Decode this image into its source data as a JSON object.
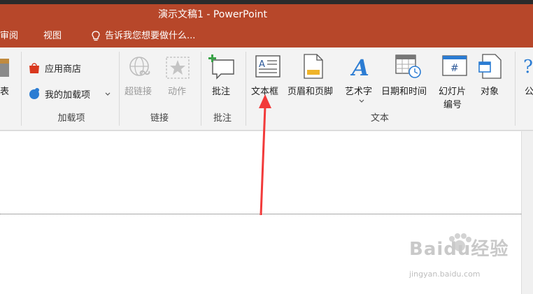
{
  "window": {
    "title": "演示文稿1 - PowerPoint"
  },
  "menu": {
    "tabs": [
      {
        "label": "审阅"
      },
      {
        "label": "视图"
      }
    ],
    "tell_me": "告诉我您想要做什么..."
  },
  "ribbon": {
    "partial_left_label": "表",
    "addins": {
      "store_label": "应用商店",
      "my_addins_label": "我的加载项",
      "group_label": "加载项"
    },
    "links": {
      "hyperlink_label": "超链接",
      "action_label": "动作",
      "group_label": "链接"
    },
    "comments": {
      "comment_label": "批注",
      "group_label": "批注"
    },
    "text": {
      "textbox_label": "文本框",
      "header_footer_label": "页眉和页脚",
      "wordart_label": "艺术字",
      "datetime_label": "日期和时间",
      "slide_number_label_1": "幻灯片",
      "slide_number_label_2": "编号",
      "object_label": "对象",
      "group_label": "文本"
    },
    "partial_right_label": "公"
  },
  "watermark": {
    "main": "Baidu经验",
    "sub": "jingyan.baidu.com"
  },
  "colors": {
    "accent": "#b7472a",
    "ribbon_bg": "#f3f3f3",
    "arrow": "#f23a3a"
  }
}
